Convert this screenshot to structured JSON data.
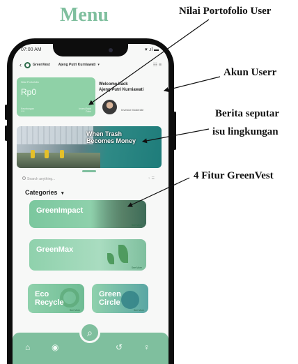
{
  "figure": {
    "title": "Menu",
    "annotations": {
      "portfolio": "Nilai Portofolio User",
      "account": "Akun Userr",
      "news_line1": "Berita seputar",
      "news_line2": "isu lingkungan",
      "features": "4 Fitur GreenVest"
    }
  },
  "status_bar": {
    "time": "07:00 AM",
    "icons": "▾ .ıl ▬"
  },
  "header": {
    "back_icon": "‹",
    "brand": "GreenVest",
    "user_name": "Ajeng Putri Kurniawati",
    "dropdown_icon": "▾",
    "icons": "☷ ≡"
  },
  "portfolio_card": {
    "label": "Nilai Portofolio",
    "value": "Rp0",
    "left_caption": "Keuntungan",
    "left_value": "****",
    "right_caption": "Invest Awal",
    "right_value": "Cairs"
  },
  "welcome": {
    "line1": "Welcome back",
    "line2": "Ajeng Putri Kurniawati",
    "level": "Investor Moderate"
  },
  "banner": {
    "line1": "When Trash",
    "line2": "Becomes Money"
  },
  "search": {
    "placeholder": "Search anything...",
    "mic_icon": "♀ ☰"
  },
  "categories": {
    "label": "Categories",
    "chevron": "▾"
  },
  "features": [
    {
      "title": "GreenImpact",
      "see_more": "See More"
    },
    {
      "title": "GreenMax",
      "see_more": "See More"
    },
    {
      "title_line1": "Eco",
      "title_line2": "Recycle",
      "see_more": "See More"
    },
    {
      "title_line1": "Green",
      "title_line2": "Circle",
      "see_more": "See More"
    }
  ],
  "nav": {
    "home": "⌂",
    "explore": "◉",
    "search": "⌕",
    "history": "↺",
    "profile": "♀"
  },
  "colors": {
    "accent": "#7fbf9e",
    "dark_green": "#2d6b4a"
  }
}
